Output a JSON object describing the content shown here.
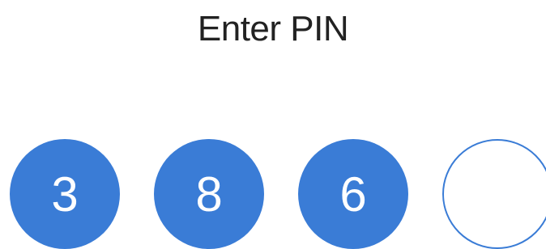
{
  "title": "Enter PIN",
  "pin": {
    "digits": [
      "3",
      "8",
      "6",
      ""
    ],
    "entered_count": 3,
    "length": 4
  },
  "colors": {
    "accent": "#3a7cd6",
    "title_text": "#222222",
    "background": "#ffffff"
  }
}
